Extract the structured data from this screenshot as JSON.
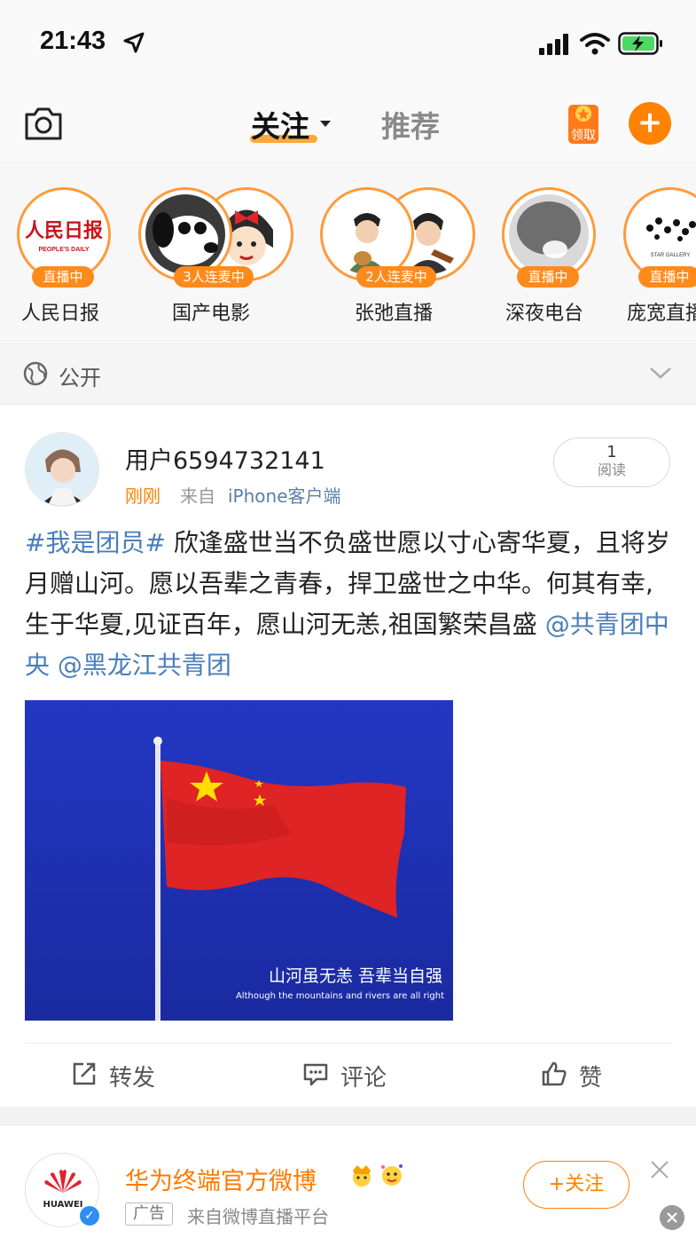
{
  "status_bar": {
    "time": "21:43",
    "icons": [
      "location-arrow-icon",
      "cellular-signal-icon",
      "wifi-icon",
      "battery-charging-icon"
    ]
  },
  "top_nav": {
    "tab_follow": "关注",
    "tab_recommend": "推荐",
    "coupon_label": "领取",
    "colors": {
      "accent": "#ff8200",
      "inactive_tab": "#8a8a8a"
    }
  },
  "live_row": {
    "items": [
      {
        "name": "人民日报",
        "badge": "直播中",
        "logo_cn": "人民日报",
        "logo_en": "PEOPLE'S DAILY"
      },
      {
        "name": "国产电影",
        "badge": "3人连麦中"
      },
      {
        "name": "张弛直播",
        "badge": "2人连麦中"
      },
      {
        "name": "深夜电台",
        "badge": "直播中"
      },
      {
        "name": "庞宽直播",
        "badge": "直播中",
        "logo_small": "STAR GALLERY"
      }
    ]
  },
  "visibility": {
    "label": "公开"
  },
  "post": {
    "username": "用户6594732141",
    "time": "刚刚",
    "source_prefix": "来自",
    "source": "iPhone客户端",
    "read_count": "1",
    "read_label": "阅读",
    "topic": "#我是团员#",
    "body": " 欣逢盛世当不负盛世愿以寸心寄华夏，且将岁月赠山河。愿以吾辈之青春，捍卫盛世之中华。何其有幸,生于华夏,见证百年，愿山河无恙,祖国繁荣昌盛 ",
    "mention_1": "@共青团中央",
    "mention_2": "@黑龙江共青团",
    "image": {
      "caption_cn": "山河虽无恙 吾辈当自强",
      "caption_en": "Although the mountains and rivers are all right"
    },
    "actions": {
      "repost": "转发",
      "comment": "评论",
      "like": "赞"
    }
  },
  "ad": {
    "name": "华为终端官方微博",
    "logo_text": "HUAWEI",
    "tag": "广告",
    "source": "来自微博直播平台",
    "follow": "+关注"
  }
}
